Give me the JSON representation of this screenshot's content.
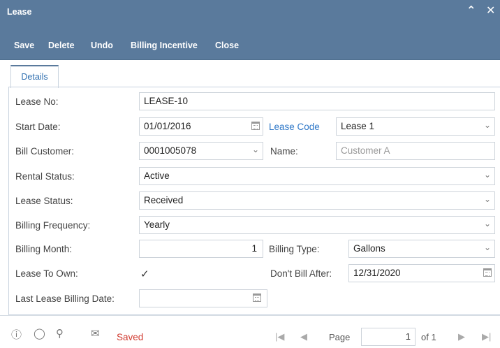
{
  "window": {
    "title": "Lease"
  },
  "toolbar": {
    "save": "Save",
    "delete": "Delete",
    "undo": "Undo",
    "billing_incentive": "Billing Incentive",
    "close": "Close"
  },
  "tabs": [
    {
      "label": "Details"
    }
  ],
  "form": {
    "lease_no": {
      "label": "Lease No:",
      "value": "LEASE-10"
    },
    "start_date": {
      "label": "Start Date:",
      "value": "01/01/2016"
    },
    "lease_code": {
      "label": "Lease Code",
      "value": "Lease 1"
    },
    "bill_customer": {
      "label": "Bill Customer:",
      "value": "0001005078"
    },
    "name": {
      "label": "Name:",
      "value": "Customer A"
    },
    "rental_status": {
      "label": "Rental Status:",
      "value": "Active"
    },
    "lease_status": {
      "label": "Lease Status:",
      "value": "Received"
    },
    "billing_frequency": {
      "label": "Billing Frequency:",
      "value": "Yearly"
    },
    "billing_month": {
      "label": "Billing Month:",
      "value": "1"
    },
    "billing_type": {
      "label": "Billing Type:",
      "value": "Gallons"
    },
    "lease_to_own": {
      "label": "Lease To Own:",
      "value": "✓"
    },
    "dont_bill_after": {
      "label": "Don't Bill After:",
      "value": "12/31/2020"
    },
    "last_lease_billing_date": {
      "label": "Last Lease Billing Date:",
      "value": ""
    }
  },
  "footer": {
    "status": "Saved",
    "page_label": "Page",
    "page_value": "1",
    "of_label": "of 1"
  },
  "colors": {
    "header": "#5a7a9c",
    "link": "#2f78c8",
    "saved": "#d03a2f"
  }
}
